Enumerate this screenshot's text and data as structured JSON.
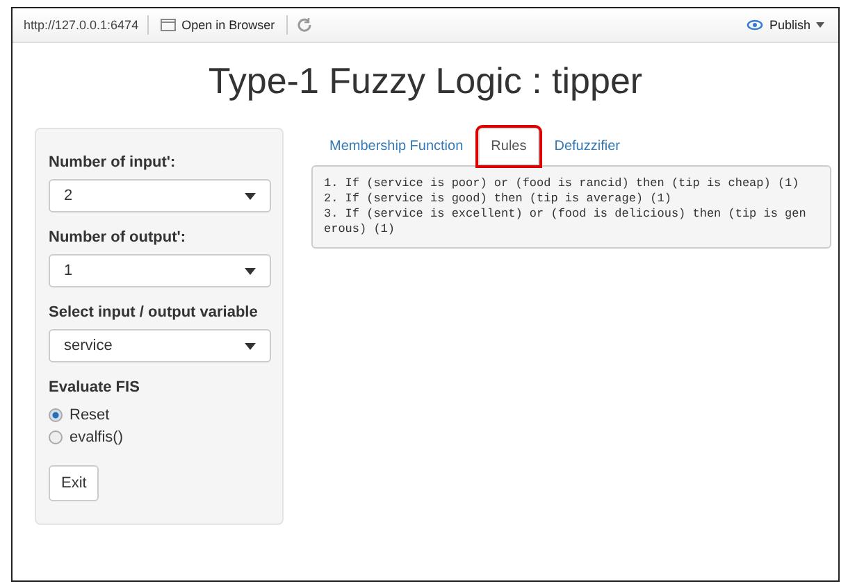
{
  "toolbar": {
    "url": "http://127.0.0.1:6474",
    "open_button": "Open in Browser",
    "publish_button": "Publish"
  },
  "title": "Type-1 Fuzzy Logic : tipper",
  "sidebar": {
    "selects": [
      {
        "label": "Number of input':",
        "value": "2"
      },
      {
        "label": "Number of output':",
        "value": "1"
      },
      {
        "label": "Select input / output variable",
        "value": "service"
      }
    ],
    "radio_group": {
      "label": "Evaluate FIS",
      "options": [
        {
          "label": "Reset",
          "selected": true
        },
        {
          "label": "evalfis()",
          "selected": false
        }
      ]
    },
    "exit_button": "Exit"
  },
  "tabs": [
    {
      "label": "Membership Function",
      "selected": false,
      "highlighted": false
    },
    {
      "label": "Rules",
      "selected": true,
      "highlighted": true
    },
    {
      "label": "Defuzzifier",
      "selected": false,
      "highlighted": false
    }
  ],
  "rules_lines": [
    "1. If (service is poor) or (food is rancid) then (tip is cheap) (1)",
    "2. If (service is good) then (tip is average) (1)",
    "3. If (service is excellent) or (food is delicious) then (tip is gen",
    "erous) (1)"
  ]
}
